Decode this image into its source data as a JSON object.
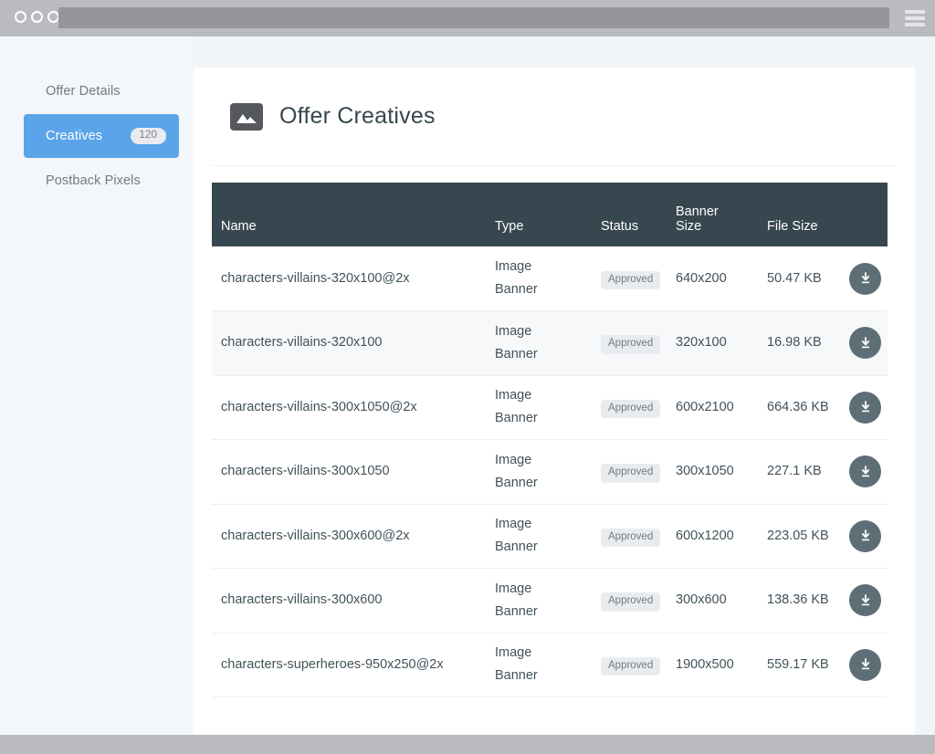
{
  "browser": {
    "dots": [
      "dot-1",
      "dot-2",
      "dot-3"
    ],
    "url_value": "",
    "menu_icon": "hamburger-icon"
  },
  "sidebar": {
    "items": [
      {
        "label": "Offer Details",
        "badge": null,
        "active": false
      },
      {
        "label": "Creatives",
        "badge": "120",
        "active": true
      },
      {
        "label": "Postback Pixels",
        "badge": null,
        "active": false
      }
    ]
  },
  "header": {
    "icon": "image-banner-icon",
    "title": "Offer Creatives"
  },
  "table": {
    "columns": [
      "Name",
      "Type",
      "Status",
      "Banner Size",
      "File Size",
      ""
    ],
    "column_banner_line1": "Banner",
    "column_banner_line2": "Size",
    "download_icon": "download-icon",
    "rows": [
      {
        "name": "characters-villains-320x100@2x",
        "type_line1": "Image",
        "type_line2": "Banner",
        "status": "Approved",
        "banner_size": "640x200",
        "file_size": "50.47 KB",
        "download": "download"
      },
      {
        "name": "characters-villains-320x100",
        "type_line1": "Image",
        "type_line2": "Banner",
        "status": "Approved",
        "banner_size": "320x100",
        "file_size": "16.98 KB",
        "download": "download"
      },
      {
        "name": "characters-villains-300x1050@2x",
        "type_line1": "Image",
        "type_line2": "Banner",
        "status": "Approved",
        "banner_size": "600x2100",
        "file_size": "664.36 KB",
        "download": "download"
      },
      {
        "name": "characters-villains-300x1050",
        "type_line1": "Image",
        "type_line2": "Banner",
        "status": "Approved",
        "banner_size": "300x1050",
        "file_size": "227.1 KB",
        "download": "download"
      },
      {
        "name": "characters-villains-300x600@2x",
        "type_line1": "Image",
        "type_line2": "Banner",
        "status": "Approved",
        "banner_size": "600x1200",
        "file_size": "223.05 KB",
        "download": "download"
      },
      {
        "name": "characters-villains-300x600",
        "type_line1": "Image",
        "type_line2": "Banner",
        "status": "Approved",
        "banner_size": "300x600",
        "file_size": "138.36 KB",
        "download": "download"
      },
      {
        "name": "characters-superheroes-950x250@2x",
        "type_line1": "Image",
        "type_line2": "Banner",
        "status": "Approved",
        "banner_size": "1900x500",
        "file_size": "559.17 KB",
        "download": "download"
      }
    ]
  },
  "colors": {
    "accent_blue": "#5ba4e9",
    "header_dark": "#37474f",
    "chrome_gray": "#b9bbbe",
    "download_btn": "#5e6e77",
    "page_bg": "#f2f5f8"
  }
}
